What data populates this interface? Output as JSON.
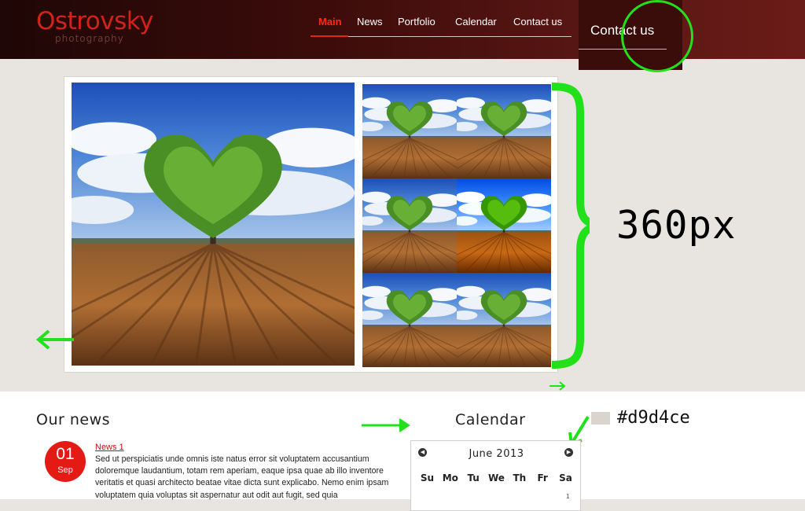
{
  "header": {
    "logo_title": "Ostrovsky",
    "logo_subtitle": "photography",
    "nav": [
      "Main",
      "News",
      "Portfolio",
      "Calendar",
      "Contact us"
    ],
    "contact_box_label": "Contact us"
  },
  "gallery": {
    "height_annotation": "360px"
  },
  "news": {
    "heading": "Our news",
    "items": [
      {
        "day": "01",
        "month": "Sep",
        "title": "News 1",
        "body": "Sed ut perspiciatis unde omnis iste natus error sit voluptatem accusantium doloremque laudantium, totam rem aperiam, eaque ipsa quae ab illo inventore veritatis et quasi architecto beatae vitae dicta sunt explicabo. Nemo enim ipsam voluptatem quia voluptas sit aspernatur aut odit aut fugit, sed quia"
      }
    ]
  },
  "calendar": {
    "heading": "Calendar",
    "month": "June 2013",
    "weekdays": [
      "Su",
      "Mo",
      "Tu",
      "We",
      "Th",
      "Fr",
      "Sa"
    ],
    "first_date": "1"
  },
  "annotation": {
    "color_label": "#d9d4ce"
  },
  "colors": {
    "accent": "#e41b15",
    "page_background": "#e8e4df",
    "annotation_green": "#22e11a",
    "swatch": "#d9d4ce"
  }
}
